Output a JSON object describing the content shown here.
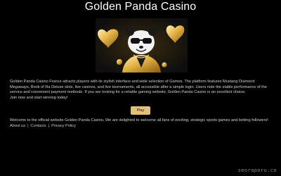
{
  "page": {
    "title": "Golden Panda Casino"
  },
  "banner": {
    "icon": "panda-mascot-with-gold-hearts"
  },
  "intro": {
    "paragraph_1": "Golden Panda Casino France attracts players with its stylish interface and wide selection of Games. The platform features Mustang Diamond Megaways, Book of Ra Deluxe slots, live casinos, and live tournaments, all accessible after a simple login. Users note the stable performance of the service and convenient payment methods. If you are looking for a reliable gaming website, Golden Panda Casino is an excellent choice.",
    "paragraph_2": "Join now and start winning today!"
  },
  "cta": {
    "play_label": "Play",
    "color": "#e3c07a"
  },
  "welcome": {
    "text": "Welcome to the official website Golden Panda Casino. We are delighted to welcome all fans of exciting, strategic sports games and betting followers!"
  },
  "footer": {
    "links": [
      "About us",
      "Contacts",
      "Privacy Policy"
    ]
  },
  "watermark": {
    "text": "seoraporu.co"
  }
}
